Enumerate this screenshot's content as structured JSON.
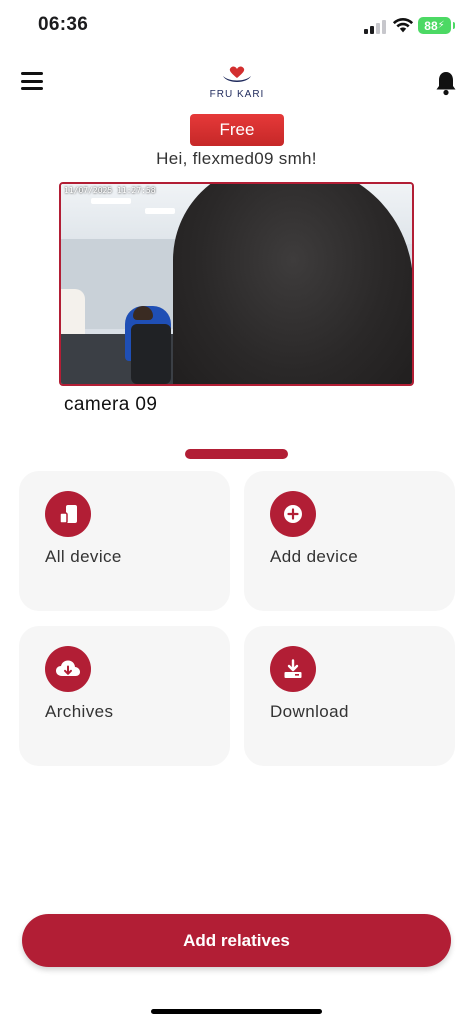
{
  "status_bar": {
    "time": "06:36",
    "battery": "88",
    "icons": [
      "cellular-signal-icon",
      "wifi-icon",
      "battery-charging-icon"
    ]
  },
  "header": {
    "menu_icon": "hamburger-menu-icon",
    "logo_text": "FRU KARI",
    "notification_icon": "bell-icon"
  },
  "account": {
    "plan": "Free",
    "greeting": "Hei, flexmed09 smh!"
  },
  "camera": {
    "name": "camera 09",
    "timestamp": "11/07/2025 11:27:58"
  },
  "tiles": [
    {
      "label": "All device",
      "icon": "devices-icon"
    },
    {
      "label": "Add device",
      "icon": "plus-circle-icon"
    },
    {
      "label": "Archives",
      "icon": "cloud-download-icon"
    },
    {
      "label": "Download",
      "icon": "download-tray-icon"
    }
  ],
  "actions": {
    "add_relatives": "Add relatives"
  },
  "colors": {
    "accent": "#b21e35",
    "badge": "#d32f2f",
    "tile_background": "#f6f6f6",
    "battery": "#4cd964"
  }
}
